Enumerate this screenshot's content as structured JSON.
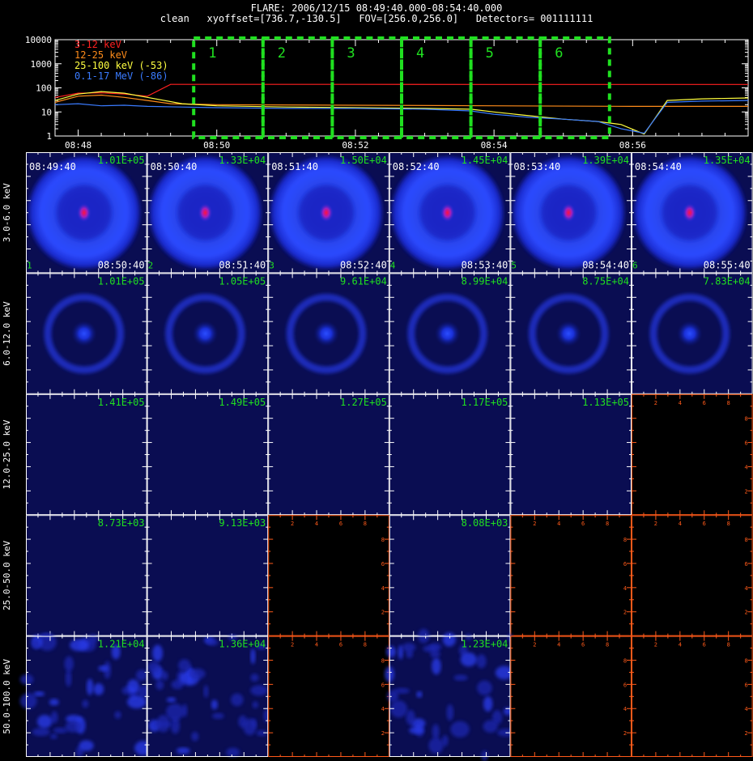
{
  "header": {
    "line1": "FLARE: 2006/12/15 08:49:40.000-08:54:40.000",
    "line2": "clean   xyoffset=[736.7,-130.5]   FOV=[256.0,256.0]   Detectors= 001111111"
  },
  "chart_data": [
    {
      "type": "line",
      "y_scale": "log",
      "ylim": [
        1,
        10000
      ],
      "y_ticks": [
        "10000",
        "1000",
        "100",
        "10",
        "1"
      ],
      "x_range": [
        "08:47:40",
        "08:57:40"
      ],
      "x_ticks": [
        "08:48",
        "08:50",
        "08:52",
        "08:54",
        "08:56"
      ],
      "legend_position": "top-left",
      "series": [
        {
          "name": "3-12 keV",
          "color": "#ff2020",
          "x": [
            "08:47:40",
            "08:48:00",
            "08:48:20",
            "08:48:40",
            "08:49:00",
            "08:49:20",
            "08:50:00",
            "08:52:00",
            "08:54:00",
            "08:56:00",
            "08:57:40"
          ],
          "y": [
            40,
            60,
            62,
            55,
            45,
            140,
            140,
            140,
            138,
            138,
            138
          ]
        },
        {
          "name": "12-25 keV",
          "color": "#ff8c1a",
          "x": [
            "08:47:40",
            "08:48:00",
            "08:48:20",
            "08:48:40",
            "08:49:00",
            "08:49:20",
            "08:50:00",
            "08:52:00",
            "08:54:00",
            "08:56:00",
            "08:57:40"
          ],
          "y": [
            25,
            45,
            50,
            40,
            30,
            22,
            20,
            19,
            18,
            17,
            17
          ]
        },
        {
          "name": "25-100 keV (-53)",
          "color": "#ffff40",
          "x": [
            "08:47:40",
            "08:48:00",
            "08:48:20",
            "08:48:40",
            "08:49:00",
            "08:49:30",
            "08:50:00",
            "08:51:00",
            "08:52:00",
            "08:53:00",
            "08:53:40",
            "08:54:00",
            "08:54:30",
            "08:55:00",
            "08:55:30",
            "08:55:50",
            "08:56:10",
            "08:56:30",
            "08:57:00",
            "08:57:40"
          ],
          "y": [
            30,
            55,
            70,
            60,
            40,
            22,
            18,
            16,
            15,
            14,
            13,
            10,
            7,
            5,
            4,
            3,
            1.2,
            30,
            35,
            38
          ]
        },
        {
          "name": "0.1-17 MeV (-86)",
          "color": "#3a7bff",
          "x": [
            "08:47:40",
            "08:48:00",
            "08:48:20",
            "08:48:40",
            "08:49:00",
            "08:49:30",
            "08:50:00",
            "08:51:00",
            "08:52:00",
            "08:53:00",
            "08:53:40",
            "08:54:00",
            "08:54:30",
            "08:55:00",
            "08:55:30",
            "08:55:50",
            "08:56:10",
            "08:56:30",
            "08:57:00",
            "08:57:40"
          ],
          "y": [
            20,
            22,
            18,
            19,
            17,
            16,
            15,
            14,
            14,
            13,
            11,
            8,
            6,
            5,
            4,
            2,
            1.3,
            25,
            28,
            30
          ]
        }
      ],
      "intervals": [
        {
          "label": "1"
        },
        {
          "label": "2"
        },
        {
          "label": "3"
        },
        {
          "label": "4"
        },
        {
          "label": "5"
        },
        {
          "label": "6"
        }
      ]
    },
    {
      "type": "heatmap",
      "row_labels": [
        "3.0-6.0 keV",
        "6.0-12.0 keV",
        "12.0-25.0 keV",
        "25.0-50.0 keV",
        "50.0-100.0 keV"
      ],
      "panels": [
        [
          {
            "max": "1.01E+05",
            "start": "08:49:40",
            "end": "08:50:40",
            "index": "1",
            "kind": "ring-core"
          },
          {
            "max": "1.33E+04",
            "start": "08:50:40",
            "end": "08:51:40",
            "index": "2",
            "kind": "ring-core"
          },
          {
            "max": "1.50E+04",
            "start": "08:51:40",
            "end": "08:52:40",
            "index": "3",
            "kind": "ring-core"
          },
          {
            "max": "1.45E+04",
            "start": "08:52:40",
            "end": "08:53:40",
            "index": "4",
            "kind": "ring-core"
          },
          {
            "max": "1.39E+04",
            "start": "08:53:40",
            "end": "08:54:40",
            "index": "5",
            "kind": "ring-core"
          },
          {
            "max": "1.35E+04",
            "start": "08:54:40",
            "end": "08:55:40",
            "index": "6",
            "kind": "ring-core"
          }
        ],
        [
          {
            "max": "1.01E+05",
            "kind": "ring"
          },
          {
            "max": "1.05E+05",
            "kind": "ring"
          },
          {
            "max": "9.61E+04",
            "kind": "ring"
          },
          {
            "max": "8.99E+04",
            "kind": "ring"
          },
          {
            "max": "8.75E+04",
            "kind": "ring"
          },
          {
            "max": "7.83E+04",
            "kind": "ring"
          }
        ],
        [
          {
            "max": "1.41E+05",
            "kind": "flat"
          },
          {
            "max": "1.49E+05",
            "kind": "flat"
          },
          {
            "max": "1.27E+05",
            "kind": "flat"
          },
          {
            "max": "1.17E+05",
            "kind": "flat"
          },
          {
            "max": "1.13E+05",
            "kind": "flat"
          },
          {
            "max": "",
            "kind": "empty"
          }
        ],
        [
          {
            "max": "8.73E+03",
            "kind": "flat"
          },
          {
            "max": "9.13E+03",
            "kind": "flat"
          },
          {
            "max": "",
            "kind": "empty"
          },
          {
            "max": "8.08E+03",
            "kind": "flat"
          },
          {
            "max": "",
            "kind": "empty"
          },
          {
            "max": "",
            "kind": "empty"
          }
        ],
        [
          {
            "max": "1.21E+04",
            "kind": "noise"
          },
          {
            "max": "1.36E+04",
            "kind": "noise"
          },
          {
            "max": "",
            "kind": "empty"
          },
          {
            "max": "1.23E+04",
            "kind": "noise"
          },
          {
            "max": "",
            "kind": "empty"
          },
          {
            "max": "",
            "kind": "empty"
          }
        ]
      ],
      "empty_axis_ticks": [
        "2",
        "4",
        "6",
        "8"
      ]
    }
  ]
}
